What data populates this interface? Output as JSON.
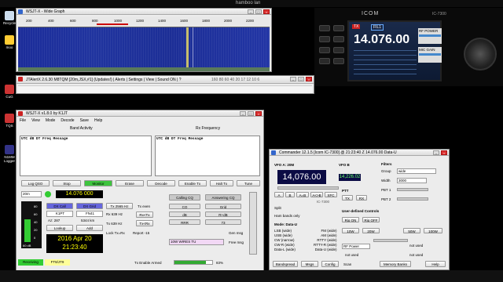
{
  "topbar": {
    "title": "hamboo lan"
  },
  "desktop": {
    "icons": [
      {
        "label": "Recycle"
      },
      {
        "label": "moo"
      },
      {
        "label": "CuG"
      },
      {
        "label": "TQS"
      },
      {
        "label": "N1MM Logger"
      }
    ]
  },
  "widegraph": {
    "title": "WSJT-X - Wide Graph",
    "scale": [
      "200",
      "400",
      "600",
      "800",
      "1000",
      "1200",
      "1400",
      "1600",
      "1800",
      "2000",
      "2200"
    ]
  },
  "jtalert": {
    "title": "JTAlertX 2.6.30 M8TQM [20m,JSX,#1] (Updates!)",
    "menu": "| Alerts | Settings | View | Sound ON | ?",
    "nums": "160 80 60 40 20 17 12 10 6"
  },
  "radio": {
    "brand": "ICOM",
    "model": "IC-7300",
    "freq": "14.076.00",
    "rfpower": "RF POWER",
    "mic": "MIC GAIN",
    "tx": "TX",
    "fil": "FIL1"
  },
  "wsjt": {
    "title": "WSJT-X   v1.8.0   by K1JT",
    "menu": [
      "File",
      "View",
      "Mode",
      "Decode",
      "Save",
      "Help"
    ],
    "band_activity": "Band Activity",
    "rx_frequency": "Rx Frequency",
    "cols_left": "UTC   dB   DT  Freq    Message",
    "cols_right": "UTC   dB   DT  Freq    Message",
    "buttons": [
      "Log QSO",
      "Stop",
      "Monitor",
      "Erase",
      "Decode",
      "Enable Tx",
      "Halt Tx",
      "Tune"
    ],
    "band": "20m",
    "dial": "14.076 000",
    "dx_call_label": "DX Call",
    "dx_grid_label": "DX Grid",
    "dx_call": "K1PT",
    "dx_grid": "FN41",
    "az": "Az: 287",
    "dist": "5344 km",
    "lookup": "Lookup",
    "add": "Add",
    "date": "2016 Apr 20",
    "time": "21:23:40",
    "tx_label": "Tx 2565 Hz",
    "rx_label": "Rx 639 Hz",
    "tx2": "Tx 639 Hz",
    "lock": "Lock Tx=Rx",
    "report": "Report -15",
    "tx_even": "Tx even",
    "rx_tx": "Rx<Tx",
    "tx_rx": "Tx<Rx",
    "calling_cq": "Calling CQ",
    "answering_cq": "Answering CQ",
    "cq": "CQ",
    "grid": "Grid",
    "db": "dB",
    "rdb": "R+dB",
    "rrr": "RRR",
    "s73": "73",
    "gen_msg": "Gen msg",
    "free_msg_value": "10W WIRES TU",
    "free_msg": "Free msg",
    "receiving": "Receiving",
    "ft8": "FT8/JT9",
    "tx_enable": "Tx Enable Armed",
    "progress": "83%",
    "progress_value": 0.83,
    "level": "60 dB",
    "level_value": 0.6,
    "scale_vals": [
      "80",
      "60",
      "40",
      "20",
      "0"
    ]
  },
  "commander": {
    "title": "Commander 12.1.5 [Icom IC-7300] @ 21:23:40 Z  14.076.00 Data-U",
    "vfo_a": "VFO A: 20M",
    "freq": "14,076.00",
    "vfo_b": "VFO B",
    "vfo_b_freq": "14,226.02",
    "filters": "Filters",
    "group": "Group",
    "group_val": "wide",
    "width": "Width",
    "width_val": "3000",
    "pbt1": "PBT 1",
    "pbt2": "PBT 2",
    "ptt": "PTT",
    "split": "Split",
    "hambands": "Ham bands only",
    "mode": "Mode: Data-U",
    "modes_left": [
      "LSB (wide)",
      "USB (wide)",
      "CW (narrow)",
      "CW-R (wide)",
      "Data-L (wide)"
    ],
    "modes_right": [
      "FM (wide)",
      "AM (wide)",
      "RTTY (wide)",
      "RTTY-R (wide)",
      "Data-U (wide)"
    ],
    "user_controls": "User-defined Controls",
    "rig_on": "Rig ON",
    "rig_off": "Rig OFF",
    "power": [
      "10W",
      "20W",
      "50W",
      "100W"
    ],
    "rf_power": "RF Power",
    "not_used": "not used",
    "bandspread": "Bandspread",
    "msgs": "Msgs",
    "config": "Config",
    "scan": "Scan",
    "memory": "Memory Banks",
    "help": "Help",
    "abbtns": [
      "A",
      "B",
      "A=B",
      "A<>B",
      "XFC"
    ],
    "tx_btn": "TX",
    "rx_btn": "RX",
    "ic7300": "IC-7300",
    "dial_small": "14,076"
  }
}
